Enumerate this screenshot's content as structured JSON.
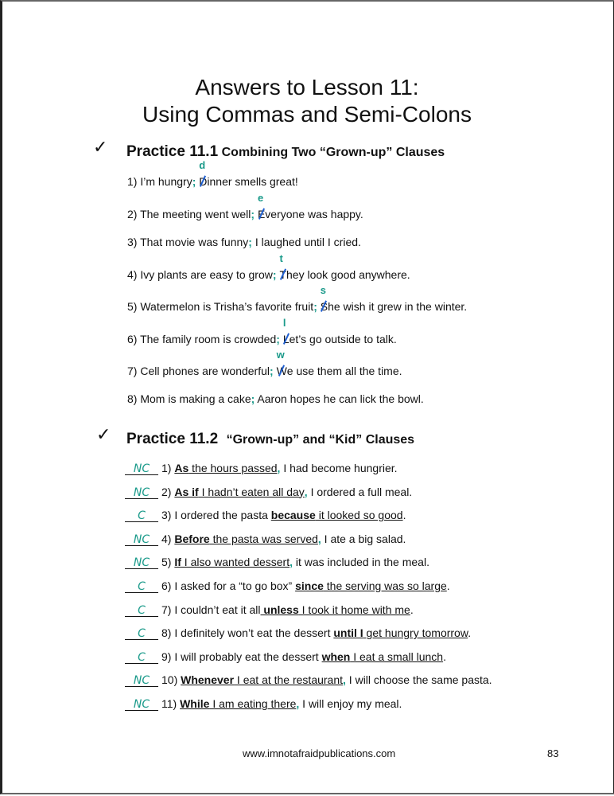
{
  "title": {
    "line1": "Answers to Lesson 11:",
    "line2": "Using Commas and Semi-Colons"
  },
  "colors": {
    "correction": "#1a9a8a",
    "strike": "#1f5fd0"
  },
  "practice1": {
    "check_icon": "✓",
    "heading": "Practice 11.1",
    "subheading": "Combining Two “Grown-up” Clauses",
    "items": [
      {
        "num": "1)",
        "before": "I’m hungry",
        "semi": ";",
        "orig_cap": "D",
        "lower": "d",
        "after": "inner smells great!"
      },
      {
        "num": "2)",
        "before": "The meeting went well",
        "semi": ";",
        "orig_cap": "E",
        "lower": "e",
        "after": "veryone was happy."
      },
      {
        "num": "3)",
        "before": "That movie was funny",
        "semi": ";",
        "orig_cap": "",
        "lower": "",
        "after": " I laughed until I cried."
      },
      {
        "num": "4)",
        "before": "Ivy plants are easy to grow",
        "semi": ";",
        "orig_cap": "T",
        "lower": "t",
        "after": "hey look good anywhere."
      },
      {
        "num": "5)",
        "before": "Watermelon is Trisha’s favorite fruit",
        "semi": ";",
        "orig_cap": "S",
        "lower": "s",
        "after": "he wish it grew in the winter."
      },
      {
        "num": "6)",
        "before": "The family room is crowded",
        "semi": ";",
        "orig_cap": "L",
        "lower": "l",
        "after": "et’s go outside to talk."
      },
      {
        "num": "7)",
        "before": "Cell phones are wonderful",
        "semi": ";",
        "orig_cap": "W",
        "lower": "w",
        "after": "e use them all the time."
      },
      {
        "num": "8)",
        "before": "Mom is making a cake",
        "semi": ";",
        "orig_cap": "",
        "lower": "",
        "after": " Aaron hopes he can lick the bowl."
      }
    ]
  },
  "practice2": {
    "check_icon": "✓",
    "heading": "Practice 11.2",
    "subheading": "“Grown-up” and “Kid” Clauses",
    "items": [
      {
        "answer": "NC",
        "num": "1)",
        "parts": [
          {
            "t": "As",
            "b": true,
            "u": true
          },
          {
            "t": " the hours passed",
            "u": true
          },
          {
            "t": ",",
            "c": true
          },
          {
            "t": "  I had become hungrier."
          }
        ]
      },
      {
        "answer": "NC",
        "num": "2)",
        "parts": [
          {
            "t": "As if",
            "b": true,
            "u": true
          },
          {
            "t": " I hadn’t eaten all day",
            "u": true
          },
          {
            "t": ",",
            "c": true
          },
          {
            "t": "  I ordered a full meal."
          }
        ]
      },
      {
        "answer": "C",
        "num": "3)",
        "parts": [
          {
            "t": "I ordered the pasta "
          },
          {
            "t": "because",
            "b": true,
            "u": true
          },
          {
            "t": " it looked so good",
            "u": true
          },
          {
            "t": "."
          }
        ]
      },
      {
        "answer": "NC",
        "num": "4)",
        "parts": [
          {
            "t": "Before",
            "b": true,
            "u": true
          },
          {
            "t": " the pasta was served",
            "u": true
          },
          {
            "t": ",",
            "c": true
          },
          {
            "t": "  I ate a big salad."
          }
        ]
      },
      {
        "answer": "NC",
        "num": "5)",
        "parts": [
          {
            "t": "If",
            "b": true,
            "u": true
          },
          {
            "t": " I also wanted dessert",
            "u": true
          },
          {
            "t": ",",
            "c": true
          },
          {
            "t": "  it was included in the meal."
          }
        ]
      },
      {
        "answer": "C",
        "num": "6)",
        "parts": [
          {
            "t": "I asked for a “to go box” "
          },
          {
            "t": "since",
            "b": true,
            "u": true
          },
          {
            "t": " the serving was so large",
            "u": true
          },
          {
            "t": "."
          }
        ]
      },
      {
        "answer": "C",
        "num": "7)",
        "parts": [
          {
            "t": "I couldn’t eat it all"
          },
          {
            "t": " unless",
            "b": true,
            "u": true
          },
          {
            "t": " I took it home with me",
            "u": true
          },
          {
            "t": "."
          }
        ]
      },
      {
        "answer": "C",
        "num": "8)",
        "parts": [
          {
            "t": "I definitely won’t eat the dessert "
          },
          {
            "t": "until I",
            "b": true,
            "u": true
          },
          {
            "t": " get hungry tomorrow",
            "u": true
          },
          {
            "t": "."
          }
        ]
      },
      {
        "answer": "C",
        "num": "9)",
        "parts": [
          {
            "t": "I will probably eat the dessert "
          },
          {
            "t": "when",
            "b": true,
            "u": true
          },
          {
            "t": " I eat a small lunch",
            "u": true
          },
          {
            "t": "."
          }
        ]
      },
      {
        "answer": "NC",
        "num": "10)",
        "parts": [
          {
            "t": "Whenever",
            "b": true,
            "u": true
          },
          {
            "t": " I eat at the restaurant",
            "u": true
          },
          {
            "t": ",",
            "c": true
          },
          {
            "t": " I will choose the same pasta."
          }
        ]
      },
      {
        "answer": "NC",
        "num": "11)",
        "parts": [
          {
            "t": "While",
            "b": true,
            "u": true
          },
          {
            "t": " I am eating there",
            "u": true
          },
          {
            "t": ",",
            "c": true
          },
          {
            "t": " I will enjoy my meal."
          }
        ]
      }
    ]
  },
  "footer": {
    "website": "www.imnotafraidpublications.com",
    "page_number": "83"
  }
}
